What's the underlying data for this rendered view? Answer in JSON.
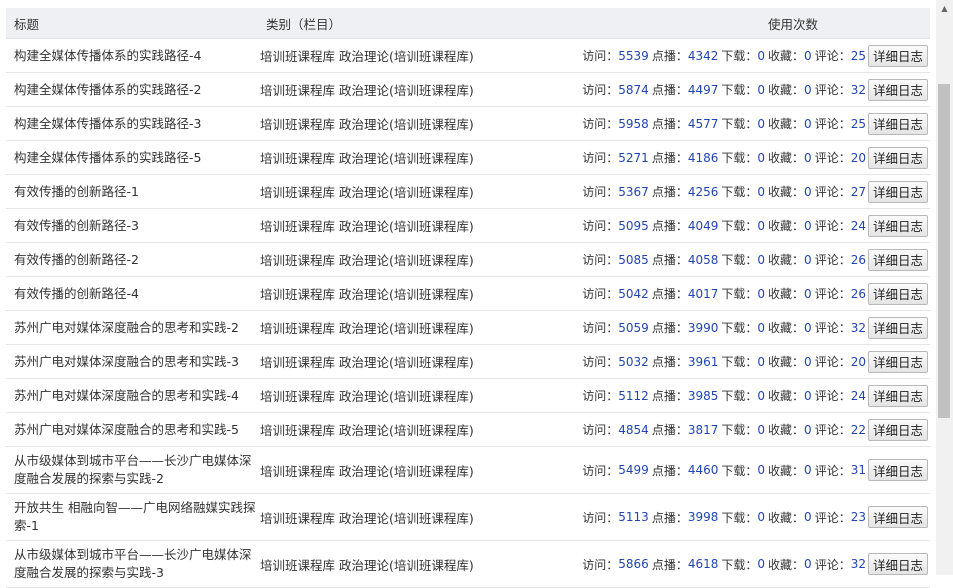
{
  "header": {
    "title": "标题",
    "category": "类别（栏目）",
    "usage": "使用次数"
  },
  "labels": {
    "visit": "访问：",
    "play": "点播：",
    "download": "下载：",
    "collect": "收藏：",
    "comment": "评论：",
    "detail": "详细日志"
  },
  "rows": [
    {
      "title": "构建全媒体传播体系的实践路径-4",
      "category": "培训班课程库 政治理论(培训班课程库)",
      "visit": "5539",
      "play": "4342",
      "download": "0",
      "collect": "0",
      "comment": "25"
    },
    {
      "title": "构建全媒体传播体系的实践路径-2",
      "category": "培训班课程库 政治理论(培训班课程库)",
      "visit": "5874",
      "play": "4497",
      "download": "0",
      "collect": "0",
      "comment": "32"
    },
    {
      "title": "构建全媒体传播体系的实践路径-3",
      "category": "培训班课程库 政治理论(培训班课程库)",
      "visit": "5958",
      "play": "4577",
      "download": "0",
      "collect": "0",
      "comment": "25"
    },
    {
      "title": "构建全媒体传播体系的实践路径-5",
      "category": "培训班课程库 政治理论(培训班课程库)",
      "visit": "5271",
      "play": "4186",
      "download": "0",
      "collect": "0",
      "comment": "20"
    },
    {
      "title": "有效传播的创新路径-1",
      "category": "培训班课程库 政治理论(培训班课程库)",
      "visit": "5367",
      "play": "4256",
      "download": "0",
      "collect": "0",
      "comment": "27"
    },
    {
      "title": "有效传播的创新路径-3",
      "category": "培训班课程库 政治理论(培训班课程库)",
      "visit": "5095",
      "play": "4049",
      "download": "0",
      "collect": "0",
      "comment": "24"
    },
    {
      "title": "有效传播的创新路径-2",
      "category": "培训班课程库 政治理论(培训班课程库)",
      "visit": "5085",
      "play": "4058",
      "download": "0",
      "collect": "0",
      "comment": "26"
    },
    {
      "title": "有效传播的创新路径-4",
      "category": "培训班课程库 政治理论(培训班课程库)",
      "visit": "5042",
      "play": "4017",
      "download": "0",
      "collect": "0",
      "comment": "26"
    },
    {
      "title": "苏州广电对媒体深度融合的思考和实践-2",
      "category": "培训班课程库 政治理论(培训班课程库)",
      "visit": "5059",
      "play": "3990",
      "download": "0",
      "collect": "0",
      "comment": "32"
    },
    {
      "title": "苏州广电对媒体深度融合的思考和实践-3",
      "category": "培训班课程库 政治理论(培训班课程库)",
      "visit": "5032",
      "play": "3961",
      "download": "0",
      "collect": "0",
      "comment": "20"
    },
    {
      "title": "苏州广电对媒体深度融合的思考和实践-4",
      "category": "培训班课程库 政治理论(培训班课程库)",
      "visit": "5112",
      "play": "3985",
      "download": "0",
      "collect": "0",
      "comment": "24"
    },
    {
      "title": "苏州广电对媒体深度融合的思考和实践-5",
      "category": "培训班课程库 政治理论(培训班课程库)",
      "visit": "4854",
      "play": "3817",
      "download": "0",
      "collect": "0",
      "comment": "22"
    },
    {
      "title": "从市级媒体到城市平台——长沙广电媒体深度融合发展的探索与实践-2",
      "category": "培训班课程库 政治理论(培训班课程库)",
      "visit": "5499",
      "play": "4460",
      "download": "0",
      "collect": "0",
      "comment": "31"
    },
    {
      "title": "开放共生 相融向智——广电网络融媒实践探索-1",
      "category": "培训班课程库 政治理论(培训班课程库)",
      "visit": "5113",
      "play": "3998",
      "download": "0",
      "collect": "0",
      "comment": "23"
    },
    {
      "title": "从市级媒体到城市平台——长沙广电媒体深度融合发展的探索与实践-3",
      "category": "培训班课程库 政治理论(培训班课程库)",
      "visit": "5866",
      "play": "4618",
      "download": "0",
      "collect": "0",
      "comment": "32"
    }
  ]
}
